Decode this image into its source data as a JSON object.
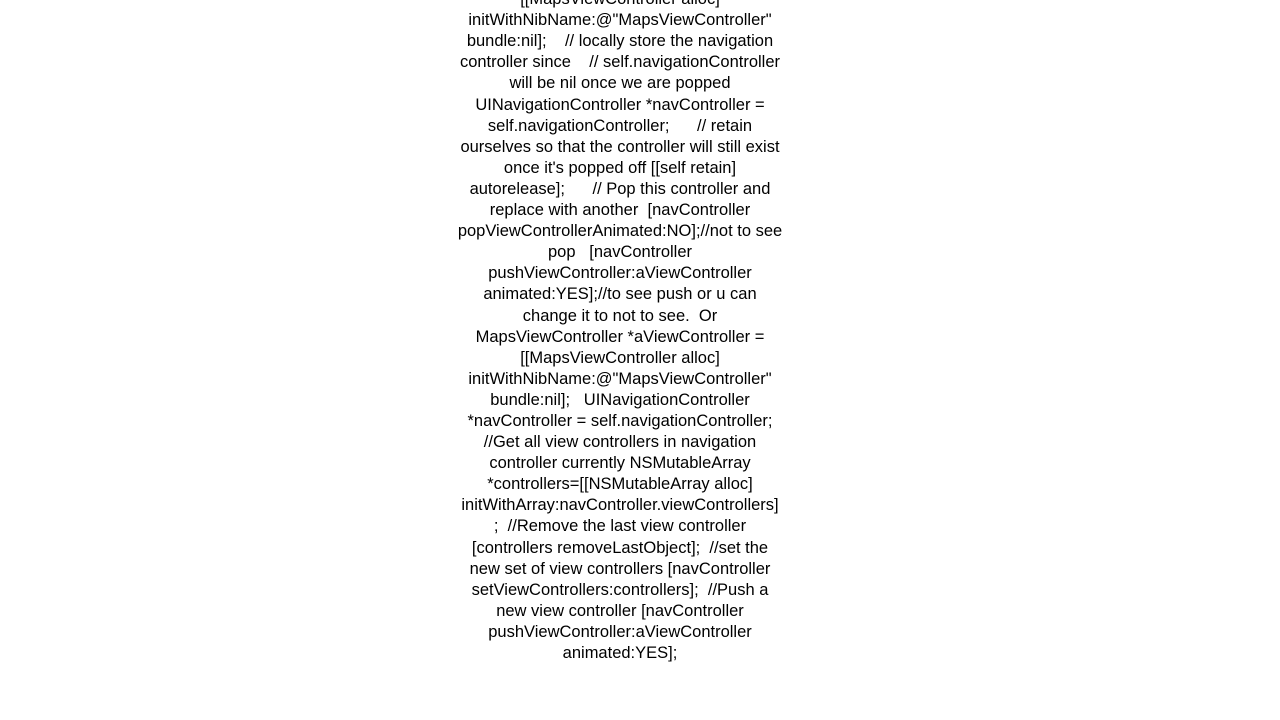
{
  "page": {
    "background_color": "#ffffff",
    "text_color": "#000000",
    "alignment": "center",
    "clipped_top": true,
    "clipped_bottom": true
  },
  "code_block": {
    "language": "Objective-C",
    "text": "MapsViewController *aViewController = [[MapsViewController alloc] initWithNibName:@\"MapsViewController\" bundle:nil];    // locally store the navigation controller since    // self.navigationController will be nil once we are popped UINavigationController *navController = self.navigationController;      // retain ourselves so that the controller will still exist once it's popped off [[self retain] autorelease];      // Pop this controller and replace with another  [navController popViewControllerAnimated:NO];//not to see pop   [navController pushViewController:aViewController animated:YES];//to see push or u can change it to not to see.  Or  MapsViewController *aViewController = [[MapsViewController alloc] initWithNibName:@\"MapsViewController\" bundle:nil];   UINavigationController *navController = self.navigationController;  //Get all view controllers in navigation controller currently NSMutableArray *controllers=[[NSMutableArray alloc] initWithArray:navController.viewControllers] ;  //Remove the last view controller [controllers removeLastObject];  //set the new set of view controllers [navController setViewControllers:controllers];  //Push a new view controller [navController pushViewController:aViewController animated:YES];",
    "visible_lines": [
      "bundle:nil];    // locally store the",
      "navigation controller since     //",
      "self.navigationController will be nil",
      "once we are popped",
      "UINavigationController *navController =",
      "self.navigationController;       //",
      "retain ourselves so that the controller",
      "will still exist once it's popped off",
      "[[self retain] autorelease];       //",
      "Pop this controller and replace with",
      "another  [navController",
      "popViewControllerAnimated:NO];//not to",
      "see pop   [navController",
      "pushViewController:aViewController",
      "animated:YES];//to see push or u can",
      "change it to not to see.  Or",
      "MapsViewController *aViewController =",
      "[[MapsViewController alloc]",
      "initWithNibName:@\"MapsViewController\"",
      "bundle:nil];   UINavigationController",
      "*navController =",
      "self.navigationController;  //Get all",
      "view controllers in navigation",
      "controller currently NSMutableArray",
      "*controllers=[[NSMutableArray alloc] ini",
      "tWithArray:navController.viewControllers",
      "] ;  //Remove the last view controller",
      "[controllers removeLastObject];  //set",
      "the new set of view controllers",
      "[navController",
      "setViewControllers:controllers];  //Push",
      "a new view controller [navController"
    ]
  }
}
